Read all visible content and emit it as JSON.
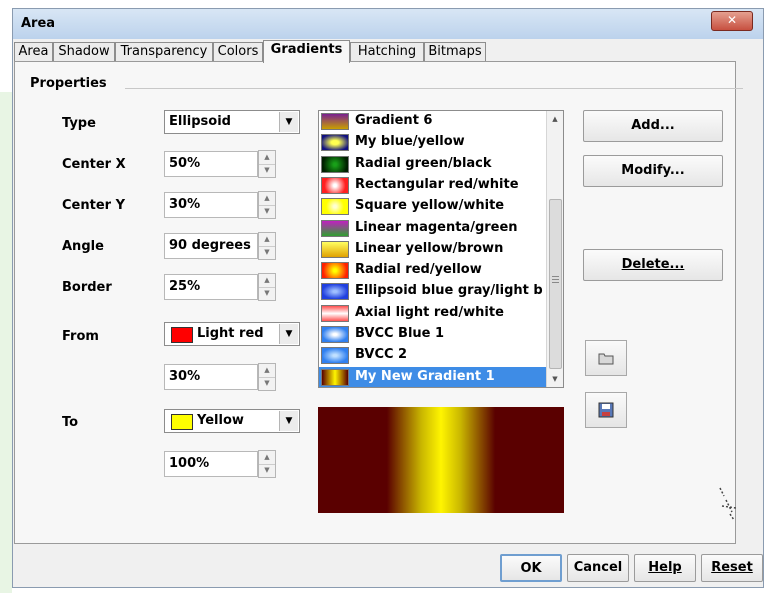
{
  "window": {
    "title": "Area",
    "close_glyph": "✕"
  },
  "tabs": [
    "Area",
    "Shadow",
    "Transparency",
    "Colors",
    "Gradients",
    "Hatching",
    "Bitmaps"
  ],
  "active_tab": "Gradients",
  "properties": {
    "group_label": "Properties",
    "type_label": "Type",
    "type_value": "Ellipsoid",
    "center_x_label": "Center X",
    "center_x_value": "50%",
    "center_y_label": "Center Y",
    "center_y_value": "30%",
    "angle_label": "Angle",
    "angle_value": "90 degrees",
    "border_label": "Border",
    "border_value": "25%",
    "from_label": "From",
    "from_color": "Light red",
    "from_color_hex": "#ff0000",
    "from_intensity": "30%",
    "to_label": "To",
    "to_color": "Yellow",
    "to_color_hex": "#ffff00",
    "to_intensity": "100%"
  },
  "gradients": [
    {
      "name": "Gradient 6",
      "swatch": "linear-gradient(#7a2090,#c8a000)"
    },
    {
      "name": "My blue/yellow",
      "swatch": "radial-gradient(ellipse,#ffff50 20%,#101080 80%)"
    },
    {
      "name": "Radial green/black",
      "swatch": "radial-gradient(circle,#18a018 10%,#002000 80%)"
    },
    {
      "name": "Rectangular red/white",
      "swatch": "radial-gradient(circle,#ffffff 10%,#ff2020 70%)"
    },
    {
      "name": "Square yellow/white",
      "swatch": "radial-gradient(circle,#ffffd0 10%,#ffff00 60%)"
    },
    {
      "name": "Linear magenta/green",
      "swatch": "linear-gradient(#c020c0,#30a030)"
    },
    {
      "name": "Linear yellow/brown",
      "swatch": "linear-gradient(#ffff60,#e0a000)"
    },
    {
      "name": "Radial red/yellow",
      "swatch": "radial-gradient(circle,#ffff00 10%,#ff2000 80%)"
    },
    {
      "name": "Ellipsoid blue gray/light b",
      "swatch": "radial-gradient(ellipse,#a0c0ff 10%,#2040e0 70%)"
    },
    {
      "name": "Axial light red/white",
      "swatch": "linear-gradient(#ff5050,#ffffff 50%,#ff5050)"
    },
    {
      "name": "BVCC Blue 1",
      "swatch": "radial-gradient(ellipse,#ffffff 10%,#3080f0 70%)"
    },
    {
      "name": "BVCC 2",
      "swatch": "radial-gradient(ellipse,#c0e0ff 10%,#3080f0 70%)"
    },
    {
      "name": "My New Gradient 1",
      "swatch": "linear-gradient(to right,#5a0000,#fff500 50%,#5a0000)"
    }
  ],
  "selected_gradient": "My New Gradient 1",
  "buttons": {
    "add": "Add...",
    "modify": "Modify...",
    "delete": "Delete..."
  },
  "file_buttons": {
    "load_icon": "folder-icon",
    "save_icon": "save-disk-icon"
  },
  "dialog_buttons": {
    "ok": "OK",
    "cancel": "Cancel",
    "help": "Help",
    "reset": "Reset"
  }
}
